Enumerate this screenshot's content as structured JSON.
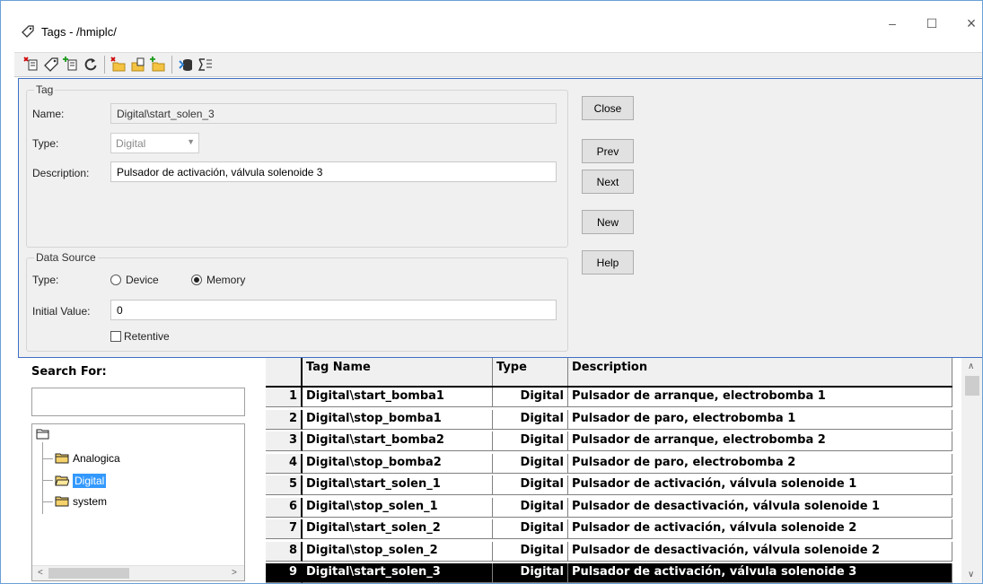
{
  "window": {
    "title": "Tags - /hmiplc/",
    "controls": {
      "minimize": "–",
      "maximize": "☐",
      "close": "×"
    }
  },
  "toolbar": {
    "icons": [
      "delete-tag-icon",
      "tag-icon",
      "new-tag-icon",
      "refresh-icon",
      "delete-folder-icon",
      "folder-tags-icon",
      "new-folder-icon",
      "database-icon",
      "sum-icon"
    ]
  },
  "tag_group": {
    "title": "Tag",
    "name_label": "Name:",
    "name_value": "Digital\\start_solen_3",
    "type_label": "Type:",
    "type_value": "Digital",
    "description_label": "Description:",
    "description_value": "Pulsador de activación, válvula solenoide 3"
  },
  "data_source": {
    "title": "Data Source",
    "type_label": "Type:",
    "option_device": "Device",
    "option_memory": "Memory",
    "selected": "Memory",
    "initial_value_label": "Initial Value:",
    "initial_value": "0",
    "retentive_label": "Retentive",
    "retentive_checked": false
  },
  "buttons": {
    "close": "Close",
    "prev": "Prev",
    "next": "Next",
    "new": "New",
    "help": "Help"
  },
  "search": {
    "label": "Search For:",
    "value": ""
  },
  "tree": {
    "folders": [
      "Analogica",
      "Digital",
      "system"
    ],
    "selected": "Digital"
  },
  "grid": {
    "headers": {
      "num": "",
      "name": "Tag Name",
      "type": "Type",
      "description": "Description"
    },
    "rows": [
      {
        "n": "1",
        "name": "Digital\\start_bomba1",
        "type": "Digital",
        "description": "Pulsador de arranque, electrobomba 1"
      },
      {
        "n": "2",
        "name": "Digital\\stop_bomba1",
        "type": "Digital",
        "description": "Pulsador de paro, electrobomba 1"
      },
      {
        "n": "3",
        "name": "Digital\\start_bomba2",
        "type": "Digital",
        "description": "Pulsador de arranque, electrobomba 2"
      },
      {
        "n": "4",
        "name": "Digital\\stop_bomba2",
        "type": "Digital",
        "description": "Pulsador de paro, electrobomba 2"
      },
      {
        "n": "5",
        "name": "Digital\\start_solen_1",
        "type": "Digital",
        "description": "Pulsador de activación, válvula solenoide 1"
      },
      {
        "n": "6",
        "name": "Digital\\stop_solen_1",
        "type": "Digital",
        "description": "Pulsador de desactivación, válvula solenoide 1"
      },
      {
        "n": "7",
        "name": "Digital\\start_solen_2",
        "type": "Digital",
        "description": "Pulsador de activación, válvula solenoide 2"
      },
      {
        "n": "8",
        "name": "Digital\\stop_solen_2",
        "type": "Digital",
        "description": "Pulsador de desactivación, válvula solenoide 2"
      },
      {
        "n": "9",
        "name": "Digital\\start_solen_3",
        "type": "Digital",
        "description": "Pulsador de activación, válvula solenoide 3"
      }
    ],
    "selected_row": "9"
  },
  "colors": {
    "panel_border": "#3c6fc4",
    "selection": "#000000",
    "folder": "#f5d26b"
  }
}
